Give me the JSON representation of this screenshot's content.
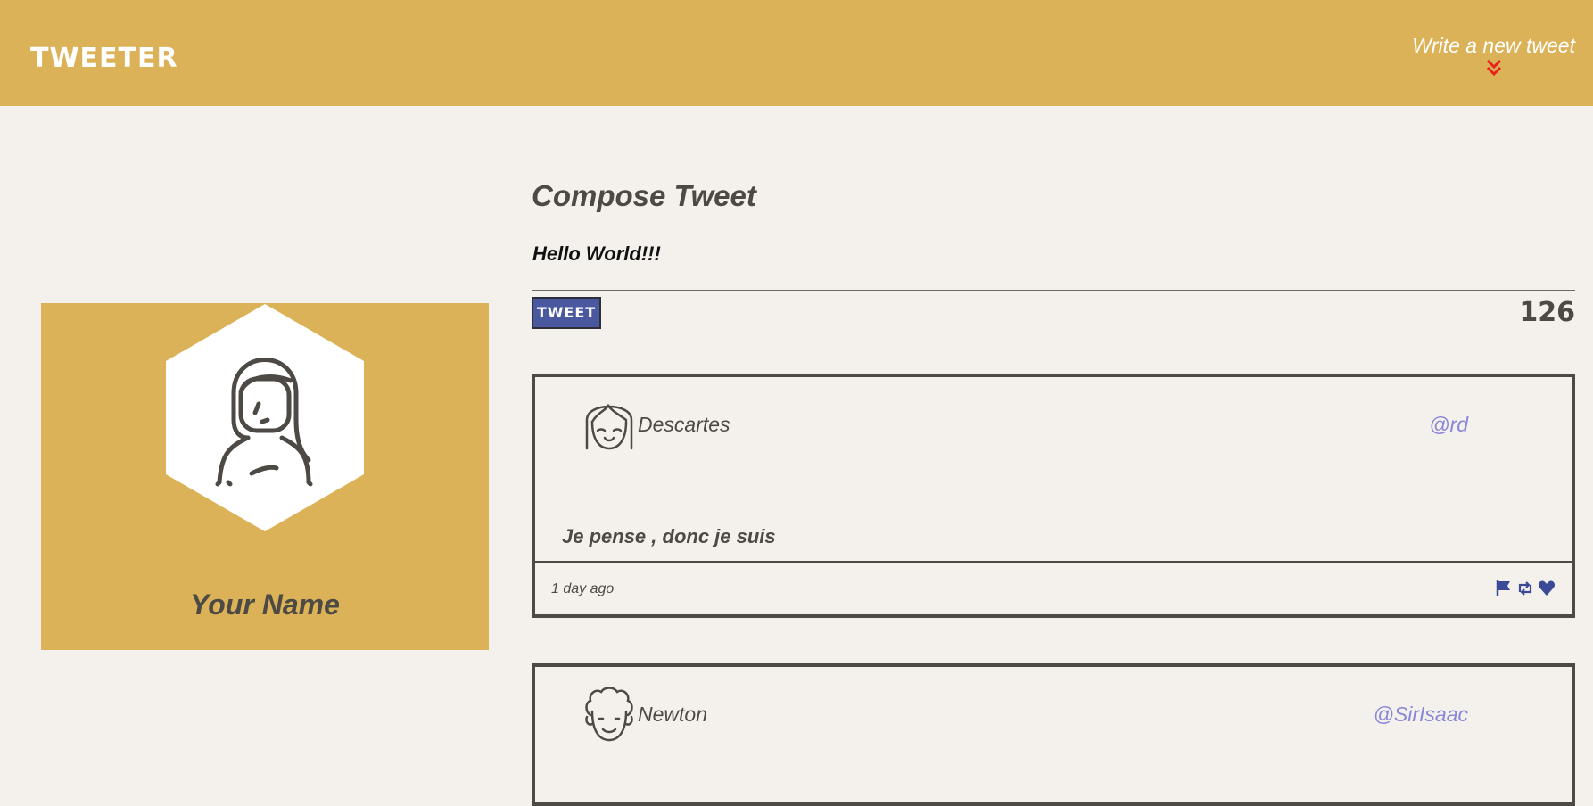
{
  "header": {
    "logo": "TWEETER",
    "write_link": "Write a new tweet"
  },
  "profile": {
    "name": "Your Name"
  },
  "compose": {
    "title": "Compose Tweet",
    "input_value": "Hello World!!!",
    "button_label": "TWEET",
    "counter": "126"
  },
  "tweets": [
    {
      "name": "Descartes",
      "handle": "@rd",
      "body": "Je pense , donc je suis",
      "time": "1 day ago"
    },
    {
      "name": "Newton",
      "handle": "@SirIsaac"
    }
  ],
  "colors": {
    "header_bg": "#dbb257",
    "page_bg": "#f4f1ec",
    "text": "#4d4944",
    "button": "#4a58a0",
    "handle": "#8a86d8",
    "chevron": "#e8231b"
  },
  "icons": {
    "write": "double-chevron-down-icon",
    "actions": [
      "flag-icon",
      "retweet-icon",
      "heart-icon"
    ]
  }
}
